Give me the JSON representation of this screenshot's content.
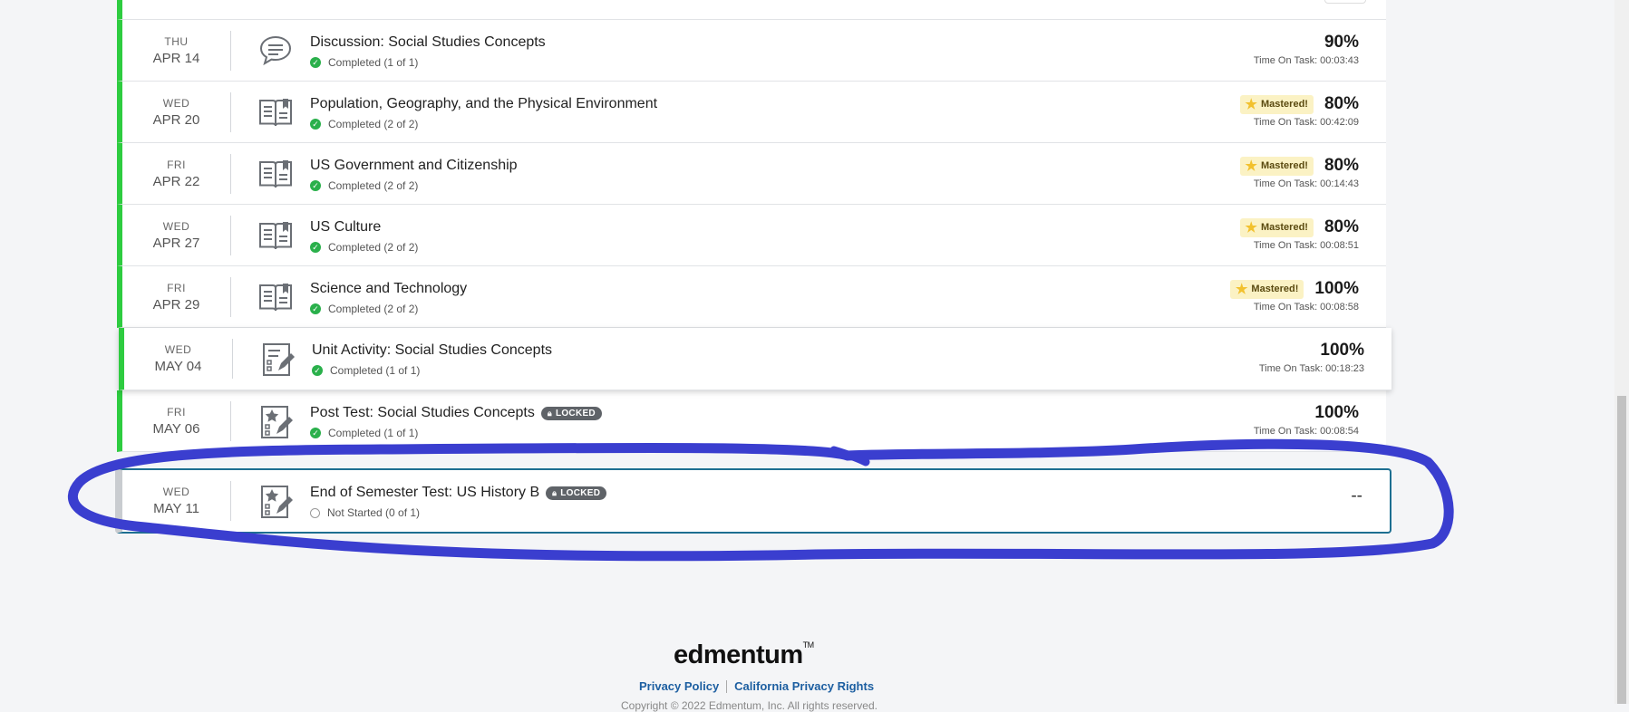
{
  "rows": [
    {
      "dow": "THU",
      "day": "APR 14",
      "title": "Discussion: Social Studies Concepts",
      "status": "Completed (1 of 1)",
      "mastered": "",
      "score": "90%",
      "time": "Time On Task: 00:03:43",
      "icon": "discussion-icon"
    },
    {
      "dow": "WED",
      "day": "APR 20",
      "title": "Population, Geography, and the Physical Environment",
      "status": "Completed (2 of 2)",
      "mastered": "Mastered!",
      "score": "80%",
      "time": "Time On Task: 00:42:09",
      "icon": "book-icon"
    },
    {
      "dow": "FRI",
      "day": "APR 22",
      "title": "US Government and Citizenship",
      "status": "Completed (2 of 2)",
      "mastered": "Mastered!",
      "score": "80%",
      "time": "Time On Task: 00:14:43",
      "icon": "book-icon"
    },
    {
      "dow": "WED",
      "day": "APR 27",
      "title": "US Culture",
      "status": "Completed (2 of 2)",
      "mastered": "Mastered!",
      "score": "80%",
      "time": "Time On Task: 00:08:51",
      "icon": "book-icon"
    },
    {
      "dow": "FRI",
      "day": "APR 29",
      "title": "Science and Technology",
      "status": "Completed (2 of 2)",
      "mastered": "Mastered!",
      "score": "100%",
      "time": "Time On Task: 00:08:58",
      "icon": "book-icon"
    },
    {
      "dow": "WED",
      "day": "MAY 04",
      "title": "Unit Activity: Social Studies Concepts",
      "status": "Completed (1 of 1)",
      "mastered": "",
      "score": "100%",
      "time": "Time On Task: 00:18:23",
      "icon": "activity-icon"
    },
    {
      "dow": "FRI",
      "day": "MAY 06",
      "title": "Post Test: Social Studies Concepts",
      "locked": "LOCKED",
      "status": "Completed (1 of 1)",
      "mastered": "",
      "score": "100%",
      "time": "Time On Task: 00:08:54",
      "icon": "test-icon"
    },
    {
      "dow": "WED",
      "day": "MAY 11",
      "title": "End of Semester Test: US History B",
      "locked": "LOCKED",
      "status": "Not Started (0 of 1)",
      "mastered": "",
      "score": "--",
      "time": "",
      "icon": "test-icon"
    }
  ],
  "footer": {
    "logo": "edmentum",
    "trademark": "TM",
    "privacy": "Privacy Policy",
    "california": "California Privacy Rights",
    "copyright": "Copyright © 2022 Edmentum, Inc. All rights reserved."
  },
  "colors": {
    "completed_bar": "#2ecc40",
    "not_started_bar": "#c9ccd0",
    "annotation": "#3a3ecf",
    "link": "#1d5fa1"
  }
}
